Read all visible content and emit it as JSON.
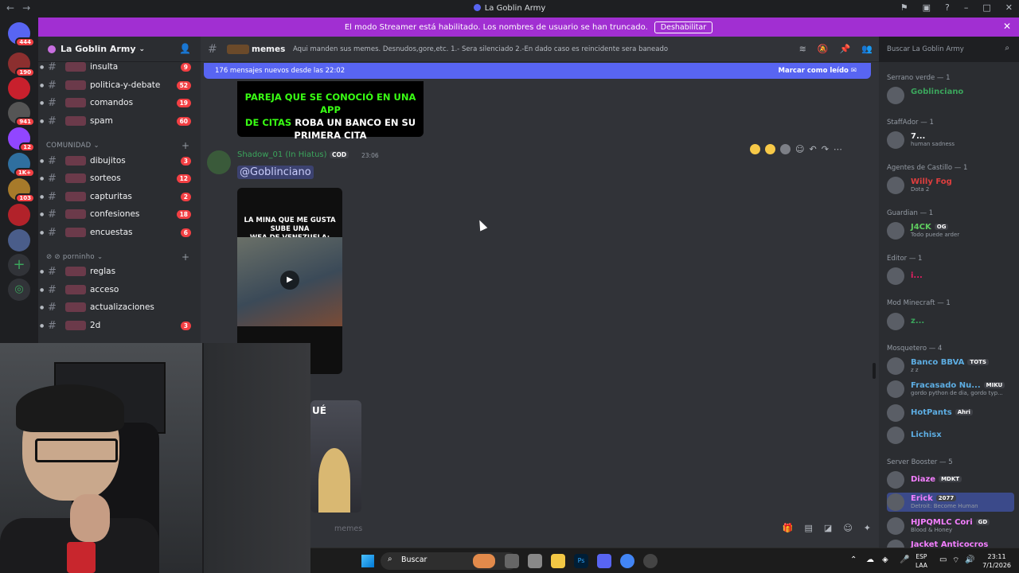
{
  "window": {
    "title": "La Goblin Army"
  },
  "banner": {
    "text": "El modo Streamer está habilitado. Los nombres de usuario se han truncado.",
    "button": "Deshabilitar"
  },
  "guilds": [
    {
      "badge": "444"
    },
    {
      "badge": "190"
    },
    {
      "badge": ""
    },
    {
      "badge": "941"
    },
    {
      "badge": "12"
    },
    {
      "badge": "1K+"
    },
    {
      "badge": "103"
    },
    {
      "badge": ""
    },
    {
      "badge": ""
    }
  ],
  "server": {
    "name": "La Goblin Army"
  },
  "channels": {
    "top": [
      {
        "name": "insulta",
        "count": "9"
      },
      {
        "name": "politica-y-debate",
        "count": "52"
      },
      {
        "name": "comandos",
        "count": "19"
      },
      {
        "name": "spam",
        "count": "60"
      }
    ],
    "category_comunidad": "COMUNIDAD",
    "comunidad": [
      {
        "name": "dibujitos",
        "count": "3"
      },
      {
        "name": "sorteos",
        "count": "12"
      },
      {
        "name": "capturitas",
        "count": "2"
      },
      {
        "name": "confesiones",
        "count": "18"
      },
      {
        "name": "encuestas",
        "count": "6"
      }
    ],
    "category_porninho": "porninho",
    "porninho": [
      {
        "name": "reglas",
        "count": ""
      },
      {
        "name": "acceso",
        "count": ""
      },
      {
        "name": "actualizaciones",
        "count": ""
      },
      {
        "name": "2d",
        "count": "3"
      }
    ]
  },
  "channel_header": {
    "name": "memes",
    "topic": "Aqui manden sus memes. Desnudos,gore,etc. 1.- Sera silenciado 2.-En dado caso es reincidente sera baneado"
  },
  "search": {
    "placeholder": "Buscar La Goblin Army"
  },
  "new_messages": {
    "text": "176 mensajes nuevos desde las 22:02",
    "action": "Marcar como leído"
  },
  "image1": {
    "line1_green": "PAREJA QUE SE CONOCIÓ EN UNA APP",
    "line2_green": "DE CITAS",
    "line2_white": " ROBA UN BANCO EN SU",
    "line3": "PRIMERA CITA"
  },
  "message": {
    "author": "Shadow_01 (In Hiatus)",
    "tag": "COD",
    "time": "23:06",
    "mention": "@Goblinciano",
    "video_caption_1": "LA MINA QUE ME GUSTA SUBE UNA",
    "video_caption_2": "WEA DE VENEZUELA:"
  },
  "image2": {
    "text": "UÉ"
  },
  "composer": {
    "placeholder": "memes"
  },
  "members": {
    "groups": [
      {
        "title": "Serrano verde — 1",
        "members": [
          {
            "name": "Goblinciano",
            "status": "",
            "badge": "",
            "color": "#3ba55c"
          }
        ]
      },
      {
        "title": "StaffAdor — 1",
        "members": [
          {
            "name": "7...",
            "status": "human sadness",
            "badge": "",
            "color": "#f2f3f5"
          }
        ]
      },
      {
        "title": "Agentes de Castillo — 1",
        "members": [
          {
            "name": "Willy Fog",
            "status": "Dota 2",
            "badge": "",
            "color": "#e03e3e"
          }
        ]
      },
      {
        "title": "Guardian — 1",
        "members": [
          {
            "name": "J4CK",
            "status": "Todo puede arder",
            "badge": "OG",
            "color": "#5fcc5f"
          }
        ]
      },
      {
        "title": "Editor — 1",
        "members": [
          {
            "name": "i...",
            "status": "",
            "badge": "",
            "color": "#e91e63"
          }
        ]
      },
      {
        "title": "Mod Minecraft — 1",
        "members": [
          {
            "name": "z...",
            "status": "",
            "badge": "",
            "color": "#3ba55c"
          }
        ]
      },
      {
        "title": "Mosquetero — 4",
        "members": [
          {
            "name": "Banco BBVA",
            "status": "z z",
            "badge": "TOTS",
            "color": "#5dade2"
          },
          {
            "name": "Fracasado Nu...",
            "status": "gordo python de dia, gordo typ...",
            "badge": "MIKU",
            "color": "#5dade2"
          },
          {
            "name": "HotPants",
            "status": "",
            "badge": "Ahri",
            "color": "#5dade2"
          },
          {
            "name": "Lichisx",
            "status": "",
            "badge": "",
            "color": "#5dade2"
          }
        ]
      },
      {
        "title": "Server Booster — 5",
        "members": [
          {
            "name": "Diaze",
            "status": "",
            "badge": "MDKT",
            "color": "#f47fff"
          },
          {
            "name": "Erick",
            "status": "Detroit: Become Human",
            "badge": "2077",
            "color": "#f47fff"
          },
          {
            "name": "HJPQMLC Cori",
            "status": "Blood & Honey",
            "badge": "GD",
            "color": "#f47fff"
          },
          {
            "name": "Jacket Anticocros",
            "status": "",
            "badge": "",
            "color": "#f47fff"
          }
        ]
      }
    ]
  },
  "taskbar": {
    "search": "Buscar",
    "lang1": "ESP",
    "lang2": "LAA",
    "time": "23:11",
    "date": "7/1/2026"
  }
}
